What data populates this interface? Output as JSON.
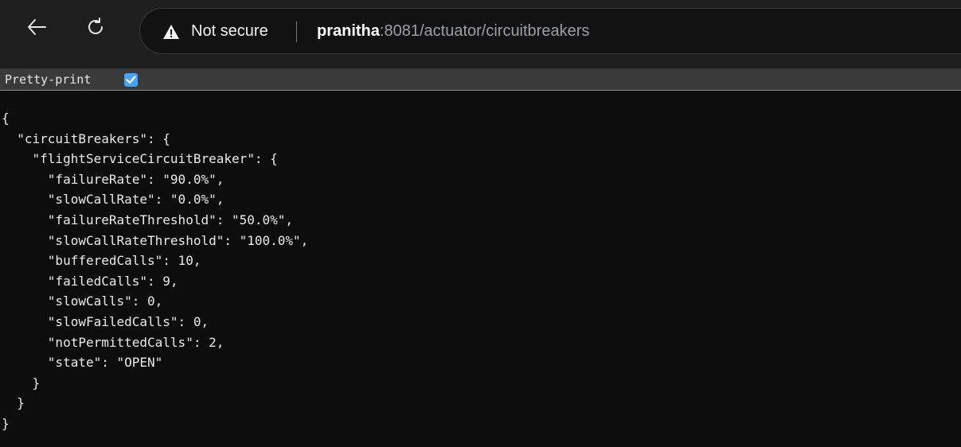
{
  "browser": {
    "security_label": "Not secure",
    "url_host": "pranitha",
    "url_rest": ":8081/actuator/circuitbreakers",
    "icons": [
      "back-arrow-icon",
      "reload-icon",
      "warning-triangle-icon"
    ]
  },
  "pretty_print": {
    "label": "Pretty-print",
    "checked": true,
    "accent": "#4aa3f0"
  },
  "json_lines": [
    "{",
    "  \"circuitBreakers\": {",
    "    \"flightServiceCircuitBreaker\": {",
    "      \"failureRate\": \"90.0%\",",
    "      \"slowCallRate\": \"0.0%\",",
    "      \"failureRateThreshold\": \"50.0%\",",
    "      \"slowCallRateThreshold\": \"100.0%\",",
    "      \"bufferedCalls\": 10,",
    "      \"failedCalls\": 9,",
    "      \"slowCalls\": 0,",
    "      \"slowFailedCalls\": 0,",
    "      \"notPermittedCalls\": 2,",
    "      \"state\": \"OPEN\"",
    "    }",
    "  }",
    "}"
  ]
}
